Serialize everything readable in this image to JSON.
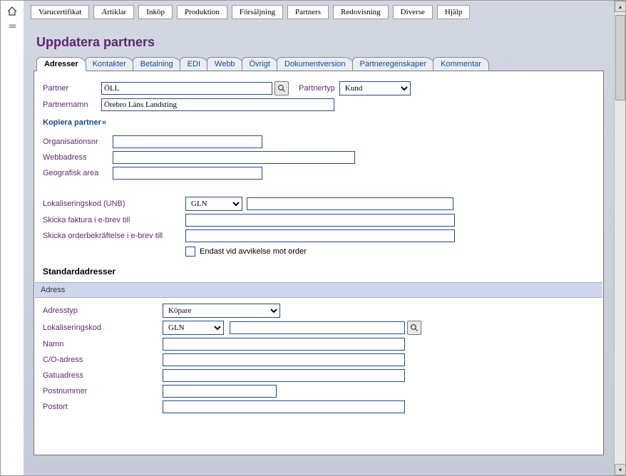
{
  "menubar": {
    "items": [
      "Varucertifikat",
      "Artiklar",
      "Inköp",
      "Produktion",
      "Försäljning",
      "Partners",
      "Redovisning",
      "Diverse",
      "Hjälp"
    ]
  },
  "heading": "Uppdatera partners",
  "tabs": [
    "Adresser",
    "Kontakter",
    "Betalning",
    "EDI",
    "Webb",
    "Övrigt",
    "Dokumentversion",
    "Partneregenskaper",
    "Kommentar"
  ],
  "active_tab_index": 0,
  "form": {
    "partner_label": "Partner",
    "partner_value": "ÖLL",
    "partnertyp_label": "Partnertyp",
    "partnertyp_value": "Kund",
    "partnernamn_label": "Partnernamn",
    "partnernamn_value": "Örebro Läns Landsting",
    "kopiera_link": "Kopiera partner",
    "kopiera_raquo": " »",
    "organisationsnr_label": "Organisationsnr",
    "organisationsnr_value": "",
    "webbadress_label": "Webbadress",
    "webbadress_value": "",
    "geografisk_area_label": "Geografisk area",
    "geografisk_area_value": "",
    "lokaliseringskod_unb_label": "Lokaliseringskod (UNB)",
    "lokaliseringskod_unb_sel": "GLN",
    "lokaliseringskod_unb_value": "",
    "skicka_faktura_label": "Skicka faktura i e-brev till",
    "skicka_faktura_value": "",
    "skicka_order_label": "Skicka orderbekräftelse i e-brev till",
    "skicka_order_value": "",
    "endast_avvikelse_label": "Endast vid avvikelse mot order",
    "endast_avvikelse_checked": false
  },
  "standard": {
    "heading": "Standardadresser",
    "subbar": "Adress",
    "adresstyp_label": "Adresstyp",
    "adresstyp_value": "Köpare",
    "lokaliseringskod_label": "Lokaliseringskod",
    "lokaliseringskod_sel": "GLN",
    "lokaliseringskod_value": "",
    "namn_label": "Namn",
    "namn_value": "",
    "co_label": "C/O-adress",
    "co_value": "",
    "gatu_label": "Gatuadress",
    "gatu_value": "",
    "postnummer_label": "Postnummer",
    "postnummer_value": "",
    "postort_label": "Postort",
    "postort_value": ""
  },
  "icons": {
    "home": "home-icon",
    "lines": "lines-icon",
    "search": "search-icon"
  }
}
